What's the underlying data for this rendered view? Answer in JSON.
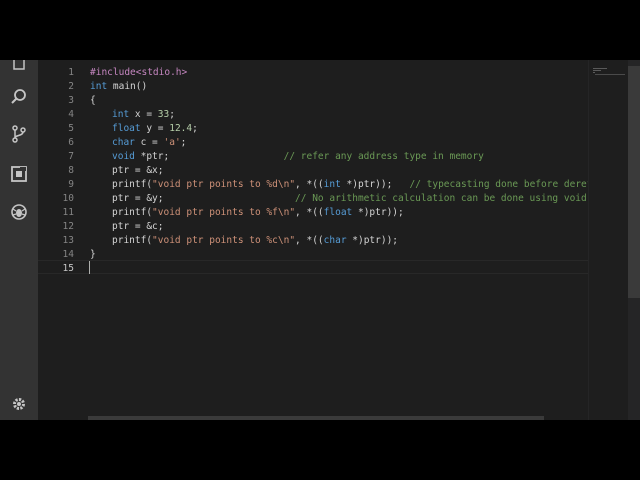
{
  "activity_bar": {
    "icons": [
      "explorer-icon",
      "search-icon",
      "source-control-icon",
      "extensions-icon",
      "debug-icon",
      "settings-gear-icon"
    ]
  },
  "editor": {
    "line_numbers": [
      "1",
      "2",
      "3",
      "4",
      "5",
      "6",
      "7",
      "8",
      "9",
      "10",
      "11",
      "12",
      "13",
      "14",
      "15"
    ],
    "lines": [
      {
        "t1": "#include<stdio.h>"
      },
      {
        "k": "int",
        "t1": " main()"
      },
      {
        "t1": "{"
      },
      {
        "k": "int",
        "t1": " x = ",
        "n": "33",
        "t2": ";"
      },
      {
        "k": "float",
        "t1": " y = ",
        "n": "12.4",
        "t2": ";"
      },
      {
        "k": "char",
        "t1": " c = ",
        "s": "'a'",
        "t2": ";"
      },
      {
        "k": "void",
        "t1": " *ptr;                    ",
        "c": "// refer any address type in memory"
      },
      {
        "t1": "ptr = &x;"
      },
      {
        "t1": "printf(",
        "s": "\"void ptr points to %d\\n\"",
        "t2": ", *((",
        "k": "int",
        "t3": " *)ptr));   ",
        "c": "// typecasting done before derefer"
      },
      {
        "t1": "ptr = &y;                       ",
        "c": "// No arithmetic calculation can be done using void po"
      },
      {
        "t1": "printf(",
        "s": "\"void ptr points to %f\\n\"",
        "t2": ", *((",
        "k": "float",
        "t3": " *)ptr));"
      },
      {
        "t1": "ptr = &c;"
      },
      {
        "t1": "printf(",
        "s": "\"void ptr points to %c\\n\"",
        "t2": ", *((",
        "k": "char",
        "t3": " *)ptr));"
      },
      {
        "t1": "}"
      },
      {
        "t1": ""
      }
    ]
  }
}
